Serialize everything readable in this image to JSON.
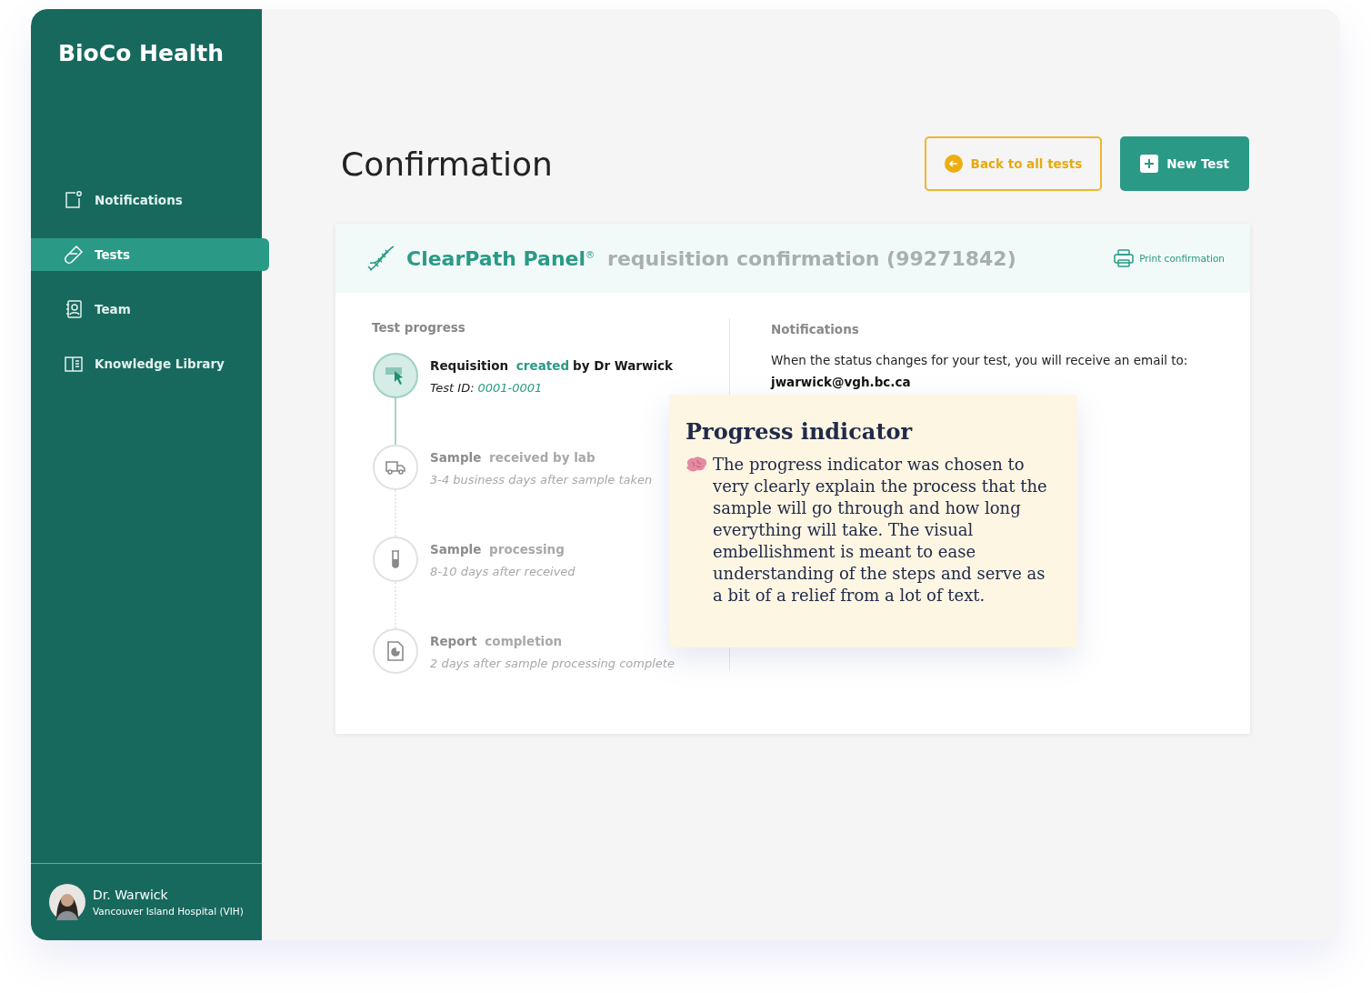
{
  "brand": "BioCo Health",
  "sidebar": {
    "items": [
      {
        "label": "Notifications",
        "kind": "notifications",
        "selected": false
      },
      {
        "label": "Tests",
        "kind": "tests",
        "selected": true
      },
      {
        "label": "Team",
        "kind": "team",
        "selected": false
      },
      {
        "label": "Knowledge Library",
        "kind": "library",
        "selected": false
      }
    ],
    "user": {
      "name": "Dr. Warwick",
      "hospital": "Vancouver Island Hospital (VIH)"
    }
  },
  "page_title": "Confirmation",
  "buttons": [
    {
      "label": "Back to all tests",
      "kind": "back"
    },
    {
      "label": "New Test",
      "kind": "new"
    }
  ],
  "panel": {
    "name": "ClearPath Panel",
    "mark": "®",
    "subtitle": "requisition confirmation (99271842)",
    "print_label": "Print confirmation"
  },
  "progress": {
    "heading": "Test progress",
    "steps": [
      {
        "kind": "request",
        "done": true,
        "title": "Requisition",
        "accent": "created",
        "rest": "by Dr Warwick",
        "detail": "Test ID:",
        "detail_value": "0001-0001"
      },
      {
        "kind": "truck",
        "done": false,
        "title": "Sample",
        "accent": "received by lab",
        "detail": "3-4 business days after sample taken"
      },
      {
        "kind": "tube",
        "done": false,
        "title": "Sample",
        "accent": "processing",
        "detail": "8-10 days after received"
      },
      {
        "kind": "report",
        "done": false,
        "title": "Report",
        "accent": "completion",
        "detail": "2 days after sample processing complete"
      }
    ]
  },
  "notifications": {
    "heading": "Notifications",
    "text": "When the status changes for your test, you will receive an email to:",
    "email": "jwarwick@vgh.bc.ca"
  },
  "note": {
    "title": "Progress indicator",
    "text": "The progress indicator was chosen to very clearly explain the process that the sample will go through and how long everything will take. The visual embellishment is meant to ease understanding of the steps and serve as a bit of a relief from a lot of text."
  }
}
